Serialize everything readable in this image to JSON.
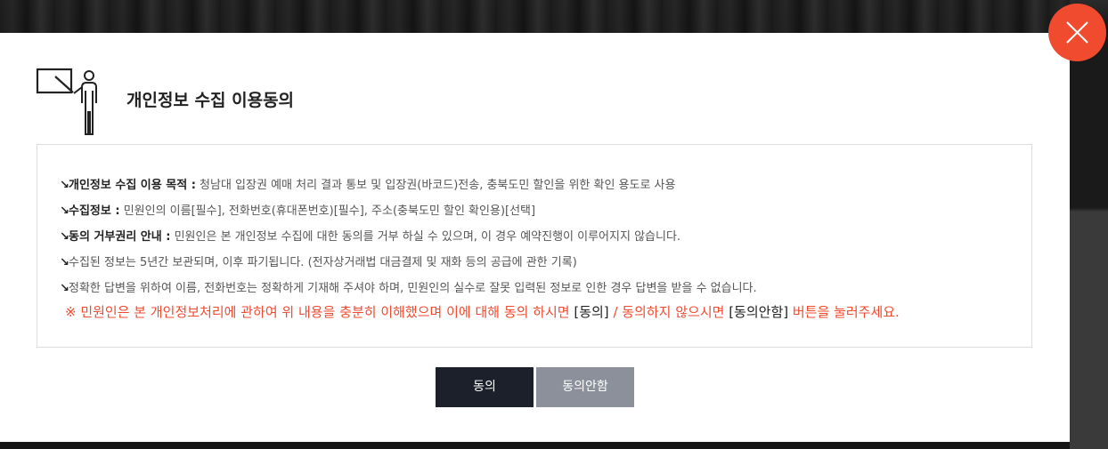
{
  "modal": {
    "title": "개인정보 수집 이용동의",
    "close_icon": "close-icon",
    "header_icon": "presenter-board-icon",
    "items": [
      {
        "key": "개인정보 수집 이용 목적 :",
        "text": " 청남대 입장권 예매 처리 결과 통보 및 입장권(바코드)전송, 충북도민 할인을 위한 확인 용도로 사용"
      },
      {
        "key": "수집정보 :",
        "text": " 민원인의 이름[필수], 전화번호(휴대폰번호)[필수], 주소(충북도민 할인 확인용)[선택]"
      },
      {
        "key": "동의 거부권리 안내 :",
        "text": " 민원인은 본 개인정보 수집에 대한 동의를 거부 하실 수 있으며, 이 경우 예약진행이 이루어지지 않습니다."
      },
      {
        "key": "",
        "text": "수집된 정보는 5년간 보관되며, 이후 파기됩니다. (전자상거래법 대금결제 및 재화 등의 공급에 관한 기록)"
      },
      {
        "key": "",
        "text": "정확한 답변을 위하여 이름, 전화번호는 정확하게 기재해 주셔야 하며, 민원인의 실수로 잘못 입력된 정보로 인한 경우 답변을 받을 수 없습니다."
      }
    ],
    "notice": {
      "part1": "※ 민원인은 본 개인정보처리에 관하여 위 내용을 충분히 이해했으며 이에 대해 동의 하시면 ",
      "agree_tag": "[동의]",
      "part2": " / 동의하지 않으시면 ",
      "disagree_tag": "[동의안함]",
      "part3": " 버튼을 눌러주세요."
    },
    "buttons": {
      "agree": "동의",
      "disagree": "동의안함"
    },
    "colors": {
      "accent": "#f04a2f",
      "agree_button": "#1c202b",
      "disagree_button": "#8b909b"
    }
  }
}
